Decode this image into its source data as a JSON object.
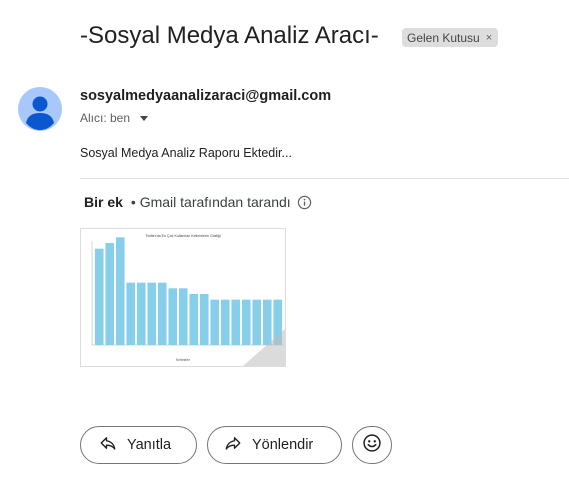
{
  "email": {
    "subject": "-Sosyal Medya Analiz Aracı-",
    "label": "Gelen Kutusu",
    "label_close": "×",
    "sender": "sosyalmedyaanalizaraci@gmail.com",
    "recipient": "Alıcı: ben",
    "body": "Sosyal Medya Analiz Raporu Ektedir..."
  },
  "attachments": {
    "count_label": "Bir ek",
    "scan_note": "• Gmail tarafından tarandı",
    "info_icon": "info-icon",
    "thumbnail": {
      "chart_data": {
        "type": "bar",
        "title": "Twitter'da En Çok Kullanılan Kelimelerin Grafiği",
        "xlabel": "Kelimeler",
        "ylabel": "",
        "values": [
          17,
          18,
          19,
          11,
          11,
          11,
          11,
          10,
          10,
          9,
          9,
          8,
          8,
          8,
          8,
          8,
          8,
          8
        ],
        "ylim": [
          0,
          18
        ],
        "bar_color": "#87ceeb"
      }
    }
  },
  "actions": {
    "reply": "Yanıtla",
    "forward": "Yönlendir",
    "emoji_icon": "emoji-icon"
  },
  "colors": {
    "avatar_bg": "#a8c7fa",
    "avatar_fg": "#0b57d0"
  }
}
